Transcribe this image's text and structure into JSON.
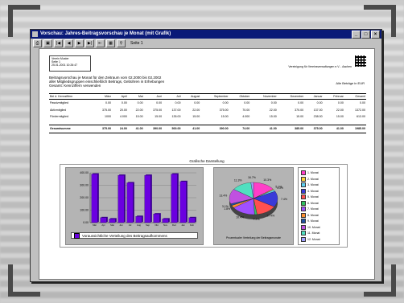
{
  "window": {
    "title": "Vorschau: Jahres-Beitragsvorschau je Monat (mit Grafik)",
    "controls": [
      "_",
      "□",
      "×"
    ]
  },
  "toolbar": {
    "buttons": [
      "⎙",
      "▣",
      "|◀",
      "◀",
      "▶",
      "▶|",
      "⇤",
      "▦",
      "⚲"
    ],
    "page_label": "Seite 1"
  },
  "report": {
    "header_box": [
      "Verein Muster",
      "Seite 1",
      "25.01.2001 10:26:47"
    ],
    "company": "Vereinigung für Vereinsverwaltungen e.V. - Aachen",
    "title_lines": [
      "Beitragsvorschau je Monat für den Zeitraum vom 02.2000 bis 02.2002",
      "aller Mitgliedsgruppen einschließlich Beitrags, Gebühren in Erhebungen",
      "Gesamt: Kennziffern verwenden"
    ],
    "page_no": "Alle Beträge in EUR",
    "table": {
      "headers": [
        "Bei d. Kennziffern",
        "März",
        "April",
        "Mai",
        "Juni",
        "Juli",
        "August",
        "September",
        "Oktober",
        "November",
        "Dezember",
        "Januar",
        "Februar",
        "Gesamt"
      ],
      "rows": [
        [
          "Passivmitglied",
          "0.00",
          "0.00",
          "0.00",
          "0.00",
          "0.00",
          "0.00",
          "0.00",
          "0.00",
          "0.00",
          "0.00",
          "0.00",
          "0.00",
          "0.00"
        ],
        [
          "Aktivmitglied",
          "375.00",
          "20.00",
          "22.00",
          "375.00",
          "137.00",
          "22.00",
          "375.00",
          "70.00",
          "22.00",
          "370.00",
          "137.00",
          "22.00",
          "1372.00"
        ],
        [
          "Fördermitglied",
          "1000",
          "4.000",
          "15.00",
          "15.00",
          "135.00",
          "15.00",
          "15.00",
          "4.000",
          "15.00",
          "15.00",
          "238.00",
          "15.00",
          "613.00"
        ]
      ],
      "total": [
        "Gesamtsumme",
        "375.00",
        "24.00",
        "41.00",
        "390.00",
        "500.00",
        "41.00",
        "390.00",
        "74.00",
        "41.00",
        "385.00",
        "375.00",
        "41.00",
        "1985.00"
      ]
    },
    "charts_title": "Grafische Darstellung",
    "pie_caption": "Prozentualer Verteilung der Beitragsmonate"
  },
  "chart_data": [
    {
      "type": "bar",
      "categories": [
        "Mär",
        "Apr",
        "Mai",
        "Jun",
        "Jul",
        "Aug",
        "Sep",
        "Okt",
        "Nov",
        "Dez",
        "Jan",
        "Feb"
      ],
      "series": [
        {
          "name": "Voraussichtliche Verteilung des Beitragsaufkommens",
          "values": [
            390,
            40,
            30,
            380,
            320,
            50,
            380,
            70,
            30,
            390,
            330,
            40
          ]
        }
      ],
      "ylim": [
        0,
        400
      ],
      "yticks": [
        "400.00",
        "300.00",
        "200.00",
        "100.00",
        "0.00"
      ],
      "color": "#6a00e0"
    },
    {
      "type": "pie",
      "labels": [
        "1. Monat",
        "2. Monat",
        "3. Monat",
        "4. Monat",
        "5. Monat",
        "6. Monat",
        "7. Monat",
        "8. Monat",
        "9. Monat",
        "10. Monat",
        "11. Monat",
        "12. Monat"
      ],
      "values": [
        18.3,
        1.1,
        2.1,
        19.5,
        17.1,
        2.1,
        19.5,
        3.1,
        2.1,
        18.5,
        16.5,
        2.1
      ],
      "slice_labels": [
        "10.3%",
        "5.1%",
        "4.3%",
        "7.4%",
        "17.4%",
        "7.2%",
        "10.4%",
        "1.8%",
        "3.1%",
        "13.4%",
        "11.3%",
        "16.7%"
      ],
      "colors": [
        "#ff3ec8",
        "#ffd23c",
        "#60d0f0",
        "#3a3ad8",
        "#ff5050",
        "#30c060",
        "#a050ff",
        "#ff9030",
        "#2050a0",
        "#c050e0",
        "#50e0c0",
        "#a0a0ff"
      ]
    }
  ]
}
